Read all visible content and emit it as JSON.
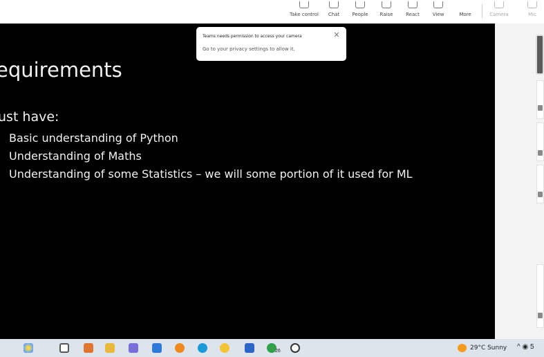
{
  "toolbar": {
    "items": [
      {
        "label": "Take control",
        "dim": false
      },
      {
        "label": "Chat",
        "dim": false
      },
      {
        "label": "People",
        "dim": false
      },
      {
        "label": "Raise",
        "dim": false
      },
      {
        "label": "React",
        "dim": false
      },
      {
        "label": "View",
        "dim": false
      },
      {
        "label": "More",
        "dim": false
      },
      {
        "label": "Camera",
        "dim": true
      },
      {
        "label": "Mic",
        "dim": true
      }
    ]
  },
  "slide": {
    "title": "equirements",
    "subtitle": "ust have:",
    "bullets": [
      "Basic understanding of Python",
      "Understanding of Maths",
      "Understanding of some Statistics – we will some portion of it used for ML"
    ]
  },
  "toast": {
    "title": "Teams needs permission to access your camera",
    "body": "Go to your privacy settings to allow it.",
    "close_icon": "close-icon"
  },
  "taskbar": {
    "weather": "29°C Sunny",
    "tray": "^ ◉ 5",
    "badge_count": "26",
    "colors": {
      "background": "#dde4ec",
      "weather_icon": "#f59a1b"
    }
  }
}
